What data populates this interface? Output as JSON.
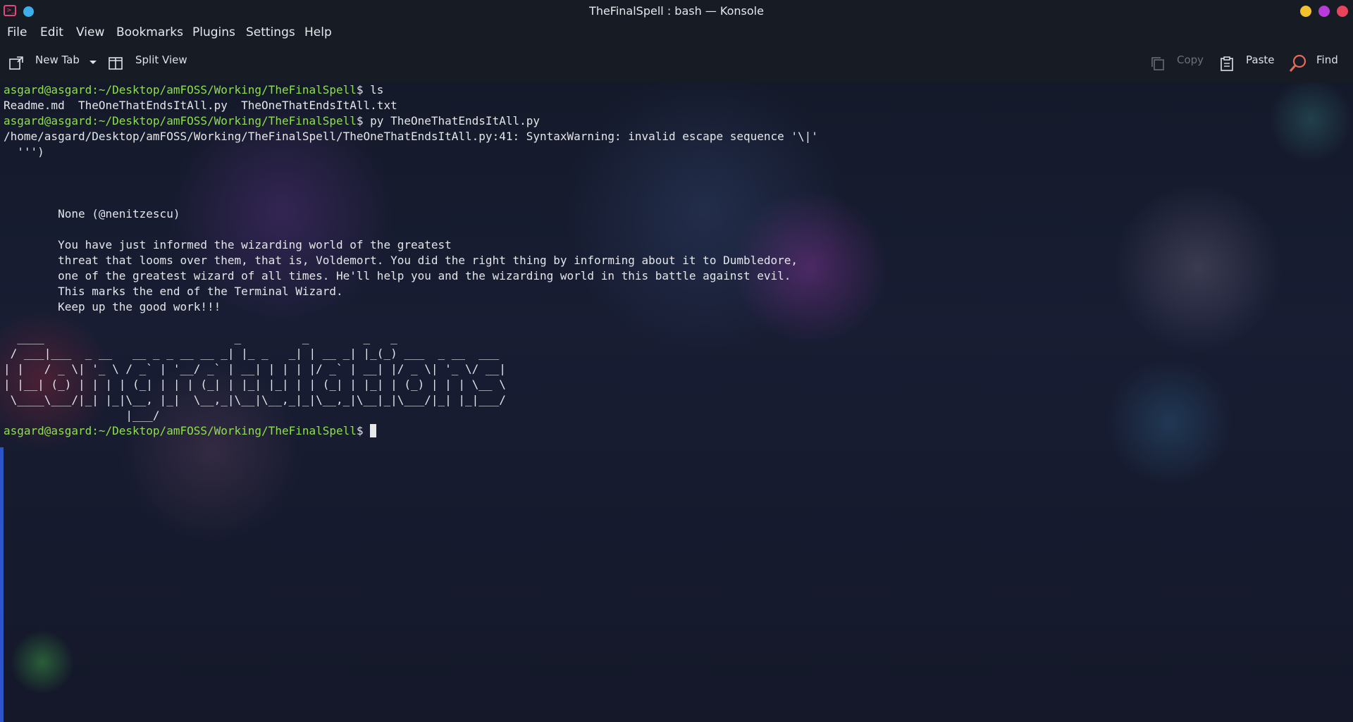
{
  "window": {
    "title": "TheFinalSpell : bash — Konsole"
  },
  "menubar": {
    "items": [
      "File",
      "Edit",
      "View",
      "Bookmarks",
      "Plugins",
      "Settings",
      "Help"
    ]
  },
  "toolbar": {
    "new_tab_label": "New Tab",
    "split_view_label": "Split View",
    "copy_label": "Copy",
    "paste_label": "Paste",
    "find_label": "Find"
  },
  "terminal": {
    "prompt": "asgard@asgard:~/Desktop/amFOSS/Working/TheFinalSpell",
    "command1": "ls",
    "ls_output": "Readme.md  TheOneThatEndsItAll.py  TheOneThatEndsItAll.txt",
    "command2": "py TheOneThatEndsItAll.py",
    "warning": "/home/asgard/Desktop/amFOSS/Working/TheFinalSpell/TheOneThatEndsItAll.py:41: SyntaxWarning: invalid escape sequence '\\|'",
    "warning_cont": "  ''')",
    "author": "        None (@nenitzescu)",
    "message_lines": [
      "        You have just informed the wizarding world of the greatest",
      "        threat that looms over them, that is, Voldemort. You did the right thing by informing about it to Dumbledore,",
      "        one of the greatest wizard of all times. He'll help you and the wizarding world in this battle against evil.",
      "        This marks the end of the Terminal Wizard.",
      "        Keep up the good work!!!"
    ],
    "ascii_art": [
      "  ____                            _         _        _   _",
      " / ___|___  _ __   __ _ _ __ __ _| |_ _   _| | __ _| |_(_) ___  _ __  ___",
      "| |   / _ \\| '_ \\ / _` | '__/ _` | __| | | | |/ _` | __| |/ _ \\| '_ \\/ __|",
      "| |__| (_) | | | | (_| | | | (_| | |_| |_| | | (_| | |_| | (_) | | | \\__ \\",
      " \\____\\___/|_| |_|\\__, |_|  \\__,_|\\__|\\__,_|_|\\__,_|\\__|_|\\___/|_| |_|___/",
      "                  |___/"
    ],
    "prompt_suffix": "$ "
  },
  "colors": {
    "prompt": "#8ee04a",
    "accent": "#2b55c9"
  }
}
